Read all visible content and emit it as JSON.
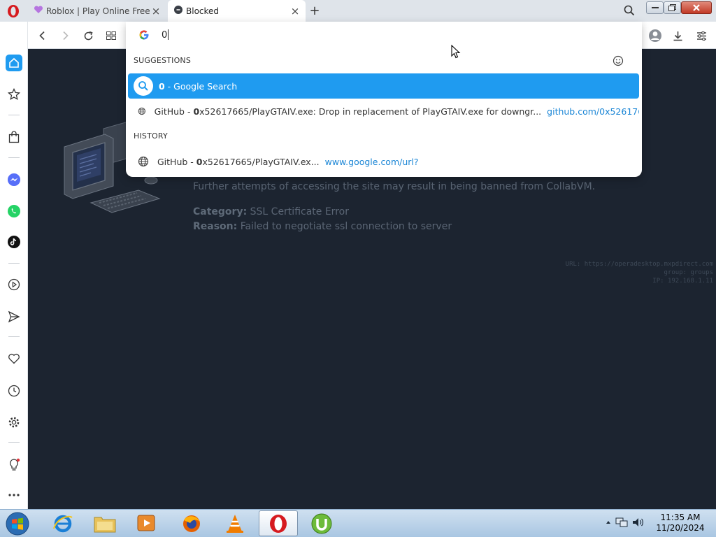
{
  "browser": {
    "tabs": [
      {
        "label": "Roblox | Play Online Free R",
        "close": "×"
      },
      {
        "label": "Blocked",
        "close": "×"
      }
    ],
    "new_tab": "+"
  },
  "omnibox": {
    "query": "0",
    "suggestions_heading": "SUGGESTIONS",
    "history_heading": "HISTORY",
    "search_row": {
      "bold": "0",
      "rest": " - Google Search"
    },
    "suggestion_row": {
      "prefix": "GitHub - ",
      "bold": "0",
      "rest": "x52617665/PlayGTAIV.exe: Drop in replacement of PlayGTAIV.exe for downgr...",
      "url": "github.com/0x52617665/Pl..."
    },
    "history_row": {
      "prefix": "GitHub - ",
      "bold": "0",
      "rest": "x52617665/PlayGTAIV.ex...",
      "url": "www.google.com/url?"
    }
  },
  "page": {
    "warning_line": "Further attempts of accessing the site may result in being banned from CollabVM.",
    "category_label": "Category:",
    "category_value": "SSL Certificate Error",
    "reason_label": "Reason:",
    "reason_value": "Failed to negotiate ssl connection to server",
    "footer": [
      "URL: https://operadesktop.mxpdirect.com",
      "group: groups",
      "IP: 192.168.1.11"
    ]
  },
  "taskbar": {
    "time": "11:35 AM",
    "date": "11/20/2024",
    "apps": [
      "internet-explorer",
      "file-explorer",
      "media-player",
      "firefox",
      "vlc",
      "opera",
      "utorrent"
    ]
  },
  "colors": {
    "accent": "#1f9bf0",
    "page_bg": "#1c2430",
    "opera_red": "#d61a1f",
    "link": "#1b86d6"
  }
}
